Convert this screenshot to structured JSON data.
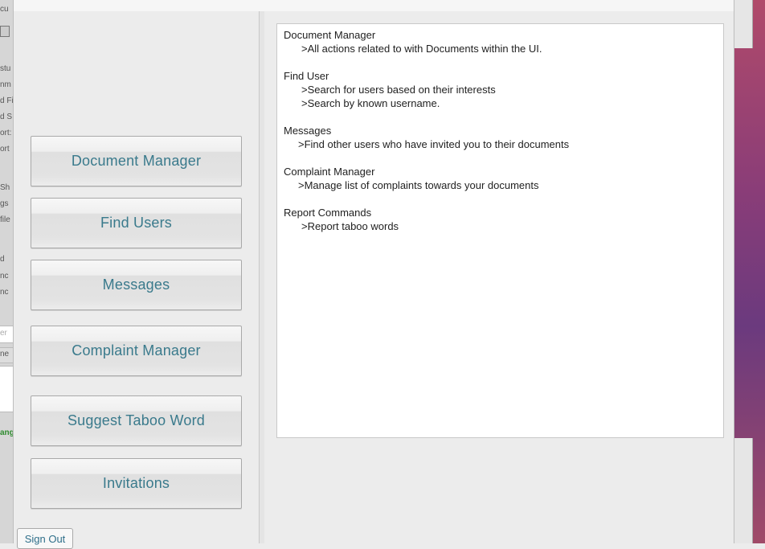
{
  "background": {
    "left_fragments": [
      "cu",
      "",
      "stu",
      "nm",
      "d Fi",
      "d S",
      "ort:",
      "ort",
      "",
      "Sh",
      "gs",
      "file",
      "",
      "d",
      "nc",
      "nc",
      "er",
      "ne",
      "",
      "",
      "ang"
    ]
  },
  "nav": {
    "buttons": [
      {
        "label": "Document Manager"
      },
      {
        "label": "Find Users"
      },
      {
        "label": "Messages"
      },
      {
        "label": "Complaint Manager"
      },
      {
        "label": "Suggest Taboo Word"
      },
      {
        "label": "Invitations"
      }
    ],
    "signout_label": "Sign Out"
  },
  "help": {
    "sections": [
      {
        "title": "Document Manager",
        "items": [
          ">All actions related to with Documents within the UI."
        ]
      },
      {
        "title": "Find User",
        "items": [
          ">Search for users based on their interests",
          ">Search by known username."
        ]
      },
      {
        "title": "Messages",
        "items": [
          ">Find other users who have invited you to their documents"
        ]
      },
      {
        "title": "Complaint Manager",
        "items": [
          ">Manage list of complaints towards your documents"
        ]
      },
      {
        "title": "Report Commands",
        "items": [
          ">Report taboo words"
        ]
      }
    ]
  },
  "colors": {
    "button_text": "#3a7a8c",
    "window_bg": "#ececec"
  }
}
